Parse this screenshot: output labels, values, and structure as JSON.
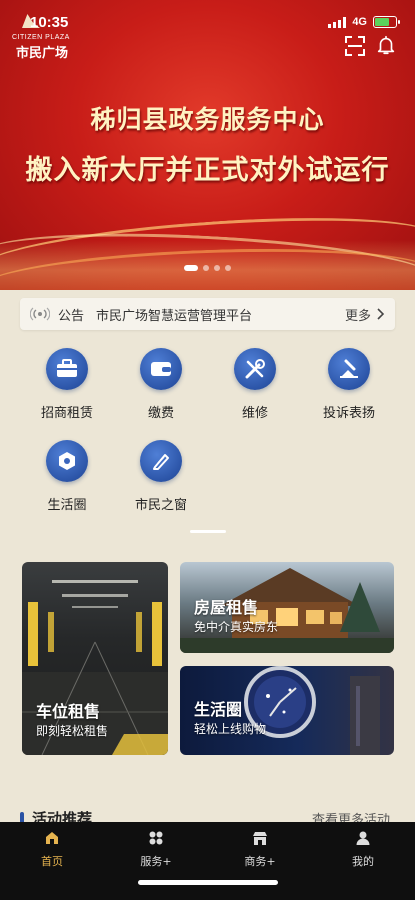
{
  "status_bar": {
    "time": "10:35",
    "network": "4G",
    "battery_level": 0.7
  },
  "logo": {
    "en": "CITIZEN PLAZA",
    "cn": "市民广场"
  },
  "banner": {
    "line1": "秭归县政务服务中心",
    "line2": "搬入新大厅并正式对外试运行",
    "slide_count": 4,
    "active_slide": 1
  },
  "notice": {
    "label": "公告",
    "text": "市民广场智慧运营管理平台",
    "more": "更多"
  },
  "functions": [
    {
      "label": "招商租赁",
      "icon": "briefcase-icon"
    },
    {
      "label": "缴费",
      "icon": "wallet-icon"
    },
    {
      "label": "维修",
      "icon": "tools-icon"
    },
    {
      "label": "投诉表扬",
      "icon": "complaint-icon"
    },
    {
      "label": "生活圈",
      "icon": "location-icon"
    },
    {
      "label": "市民之窗",
      "icon": "pen-icon"
    }
  ],
  "cards": {
    "parking": {
      "title": "车位租售",
      "subtitle": "即刻轻松租售"
    },
    "house": {
      "title": "房屋租售",
      "subtitle": "免中介真实房东"
    },
    "life": {
      "title": "生活圈",
      "subtitle": "轻松上线购物"
    }
  },
  "section": {
    "title": "活动推荐",
    "more": "查看更多活动"
  },
  "tabbar": [
    {
      "label": "首页",
      "icon": "home-icon",
      "active": true
    },
    {
      "label": "服务+",
      "icon": "grid-icon"
    },
    {
      "label": "商务+",
      "icon": "store-icon"
    },
    {
      "label": "我的",
      "icon": "user-icon"
    }
  ],
  "colors": {
    "accent": "#2c55a8",
    "tab_active": "#e5b34f",
    "banner_red": "#c81d18"
  }
}
